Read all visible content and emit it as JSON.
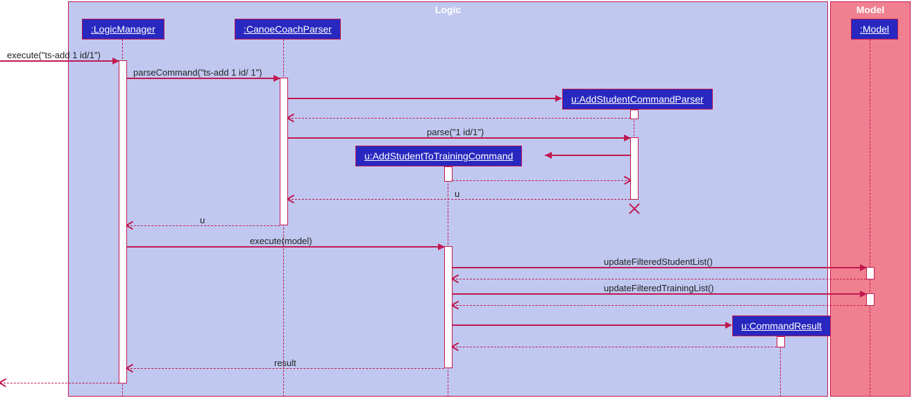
{
  "frames": {
    "logic": "Logic",
    "model": "Model"
  },
  "participants": {
    "logicManager": ":LogicManager",
    "canoeCoachParser": ":CanoeCoachParser",
    "addStudentCommandParser": "u:AddStudentCommandParser",
    "addStudentToTrainingCommand": "u:AddStudentToTrainingCommand",
    "commandResult": "u:CommandResult",
    "model": ":Model"
  },
  "messages": {
    "execute1": "execute(\"ts-add 1 id/1\")",
    "parseCommand": "parseCommand(\"ts-add 1 id/ 1\")",
    "parse": "parse(\"1 id/1\")",
    "u_return1": "u",
    "u_return2": "u",
    "executeModel": "execute(model)",
    "updateStudent": "updateFilteredStudentList()",
    "updateTraining": "updateFilteredTrainingList()",
    "result": "result"
  },
  "chart_data": {
    "type": "sequence-diagram",
    "frames": [
      {
        "name": "Logic",
        "participants": [
          "LogicManager",
          "CanoeCoachParser",
          "AddStudentCommandParser",
          "AddStudentToTrainingCommand",
          "CommandResult"
        ]
      },
      {
        "name": "Model",
        "participants": [
          "Model"
        ]
      }
    ],
    "participants": [
      {
        "id": "LogicManager",
        "label": ":LogicManager"
      },
      {
        "id": "CanoeCoachParser",
        "label": ":CanoeCoachParser"
      },
      {
        "id": "AddStudentCommandParser",
        "label": "u:AddStudentCommandParser",
        "createdBy": "CanoeCoachParser",
        "destroyed": true
      },
      {
        "id": "AddStudentToTrainingCommand",
        "label": "u:AddStudentToTrainingCommand",
        "createdBy": "AddStudentCommandParser"
      },
      {
        "id": "CommandResult",
        "label": "u:CommandResult",
        "createdBy": "AddStudentToTrainingCommand"
      },
      {
        "id": "Model",
        "label": ":Model"
      }
    ],
    "messages": [
      {
        "from": "external",
        "to": "LogicManager",
        "label": "execute(\"ts-add 1 id/1\")",
        "type": "call"
      },
      {
        "from": "LogicManager",
        "to": "CanoeCoachParser",
        "label": "parseCommand(\"ts-add 1 id/ 1\")",
        "type": "call"
      },
      {
        "from": "CanoeCoachParser",
        "to": "AddStudentCommandParser",
        "label": "",
        "type": "create"
      },
      {
        "from": "AddStudentCommandParser",
        "to": "CanoeCoachParser",
        "label": "",
        "type": "return"
      },
      {
        "from": "CanoeCoachParser",
        "to": "AddStudentCommandParser",
        "label": "parse(\"1 id/1\")",
        "type": "call"
      },
      {
        "from": "AddStudentCommandParser",
        "to": "AddStudentToTrainingCommand",
        "label": "",
        "type": "create"
      },
      {
        "from": "AddStudentToTrainingCommand",
        "to": "AddStudentCommandParser",
        "label": "",
        "type": "return"
      },
      {
        "from": "AddStudentCommandParser",
        "to": "CanoeCoachParser",
        "label": "u",
        "type": "return"
      },
      {
        "from": "AddStudentCommandParser",
        "to": null,
        "label": "",
        "type": "destroy"
      },
      {
        "from": "CanoeCoachParser",
        "to": "LogicManager",
        "label": "u",
        "type": "return"
      },
      {
        "from": "LogicManager",
        "to": "AddStudentToTrainingCommand",
        "label": "execute(model)",
        "type": "call"
      },
      {
        "from": "AddStudentToTrainingCommand",
        "to": "Model",
        "label": "updateFilteredStudentList()",
        "type": "call"
      },
      {
        "from": "Model",
        "to": "AddStudentToTrainingCommand",
        "label": "",
        "type": "return"
      },
      {
        "from": "AddStudentToTrainingCommand",
        "to": "Model",
        "label": "updateFilteredTrainingList()",
        "type": "call"
      },
      {
        "from": "Model",
        "to": "AddStudentToTrainingCommand",
        "label": "",
        "type": "return"
      },
      {
        "from": "AddStudentToTrainingCommand",
        "to": "CommandResult",
        "label": "",
        "type": "create"
      },
      {
        "from": "CommandResult",
        "to": "AddStudentToTrainingCommand",
        "label": "",
        "type": "return"
      },
      {
        "from": "AddStudentToTrainingCommand",
        "to": "LogicManager",
        "label": "result",
        "type": "return"
      },
      {
        "from": "LogicManager",
        "to": "external",
        "label": "",
        "type": "return"
      }
    ]
  }
}
